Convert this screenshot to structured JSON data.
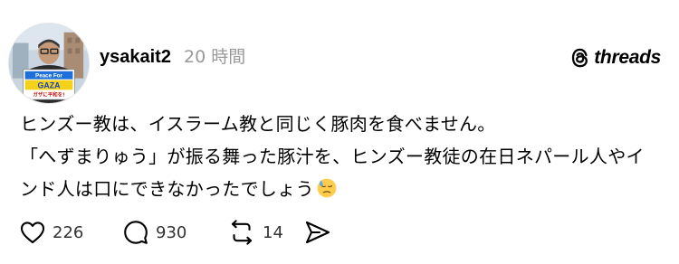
{
  "post": {
    "username": "ysakait2",
    "timestamp": "20 時間",
    "avatar_sign": {
      "line1": "Peace For",
      "line2": "GAZA",
      "line3": "ガザに平和を!"
    },
    "brand": {
      "name": "threads",
      "icon": "threads-logo-icon"
    },
    "body_lines": [
      "ヒンズー教は、イスラーム教と同じく豚肉を食べません。",
      "「へずまりゅう」が振る舞った豚汁を、ヒンズー教徒の在日ネパール人やイ",
      "ンド人は口にできなかったでしょう"
    ],
    "emoji": "downcast-sweat-face-emoji",
    "actions": {
      "like": {
        "icon": "heart-icon",
        "count": "226"
      },
      "reply": {
        "icon": "speech-bubble-icon",
        "count": "930"
      },
      "repost": {
        "icon": "repost-icon",
        "count": "14"
      },
      "share": {
        "icon": "send-icon"
      }
    },
    "colors": {
      "text": "#000000",
      "muted": "#999999",
      "count": "#333333",
      "emoji_face": "#FFCC4D",
      "emoji_sweat": "#5DADEC"
    }
  }
}
